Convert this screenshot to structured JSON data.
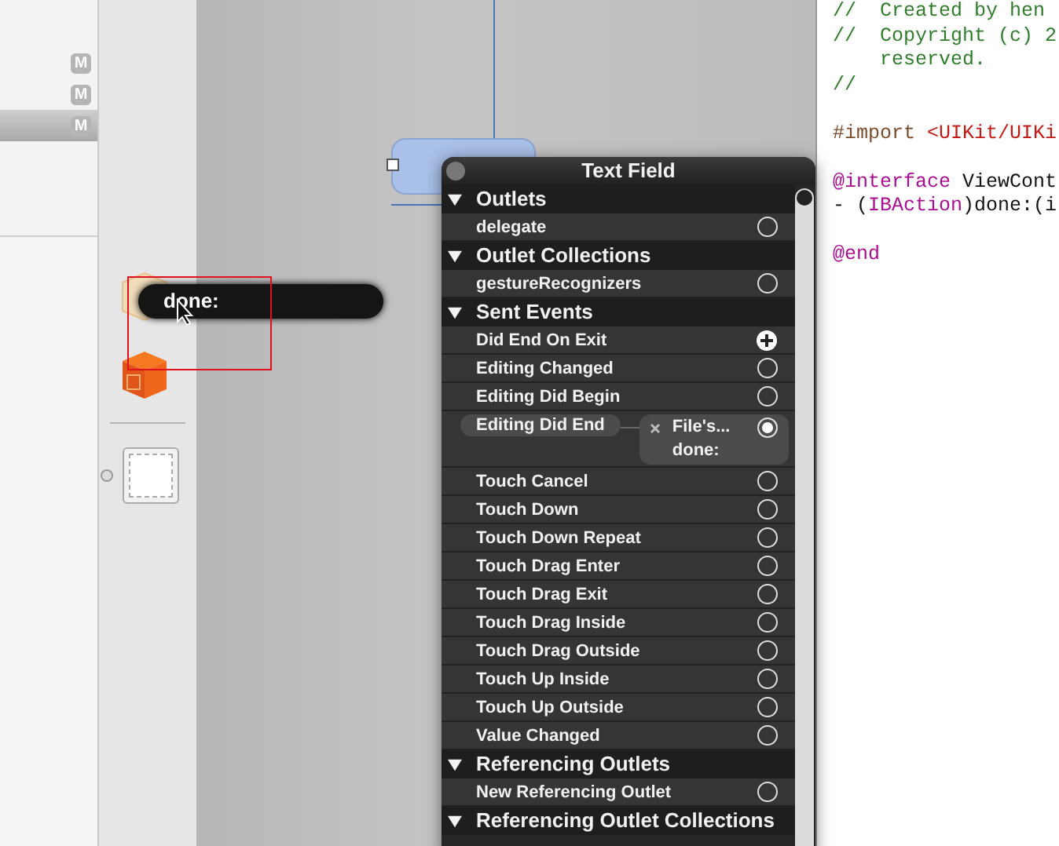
{
  "file_list": {
    "rows": [
      {
        "badge": "M",
        "selected": false
      },
      {
        "badge": "M",
        "selected": false
      },
      {
        "badge": "M",
        "selected": true
      }
    ]
  },
  "drag_tooltip": {
    "text": "done:"
  },
  "connections_panel": {
    "title": "Text Field",
    "sections": [
      {
        "title": "Outlets",
        "expanded": true,
        "rows": [
          {
            "label": "delegate",
            "kind": "empty"
          }
        ]
      },
      {
        "title": "Outlet Collections",
        "expanded": true,
        "rows": [
          {
            "label": "gestureRecognizers",
            "kind": "empty"
          }
        ]
      },
      {
        "title": "Sent Events",
        "expanded": true,
        "rows": [
          {
            "label": "Did End On Exit",
            "kind": "adding"
          },
          {
            "label": "Editing Changed",
            "kind": "empty"
          },
          {
            "label": "Editing Did Begin",
            "kind": "empty"
          },
          {
            "label": "Editing Did End",
            "kind": "connected",
            "target": "File's...",
            "action": "done:"
          },
          {
            "label": "Touch Cancel",
            "kind": "empty"
          },
          {
            "label": "Touch Down",
            "kind": "empty"
          },
          {
            "label": "Touch Down Repeat",
            "kind": "empty"
          },
          {
            "label": "Touch Drag Enter",
            "kind": "empty"
          },
          {
            "label": "Touch Drag Exit",
            "kind": "empty"
          },
          {
            "label": "Touch Drag Inside",
            "kind": "empty"
          },
          {
            "label": "Touch Drag Outside",
            "kind": "empty"
          },
          {
            "label": "Touch Up Inside",
            "kind": "empty"
          },
          {
            "label": "Touch Up Outside",
            "kind": "empty"
          },
          {
            "label": "Value Changed",
            "kind": "empty"
          }
        ]
      },
      {
        "title": "Referencing Outlets",
        "expanded": true,
        "rows": [
          {
            "label": "New Referencing Outlet",
            "kind": "empty"
          }
        ]
      },
      {
        "title": "Referencing Outlet Collections",
        "expanded": true
      }
    ]
  },
  "code_editor": {
    "blocks": [
      {
        "lines": [
          {
            "tokens": [
              {
                "kind": "comment",
                "text": "//  Created by hen"
              }
            ]
          },
          {
            "tokens": [
              {
                "kind": "comment",
                "text": "//  Copyright (c) 2"
              }
            ]
          },
          {
            "tokens": [
              {
                "kind": "comment",
                "text": "    reserved."
              }
            ]
          },
          {
            "tokens": [
              {
                "kind": "comment",
                "text": "//"
              }
            ]
          }
        ]
      },
      {
        "lines": [
          {
            "tokens": [
              {
                "kind": "directive",
                "text": "#import"
              },
              {
                "kind": "string",
                "text": " <UIKit/UIKi"
              }
            ]
          }
        ]
      },
      {
        "lines": [
          {
            "tokens": [
              {
                "kind": "keyword",
                "text": "@interface"
              },
              {
                "kind": "plain",
                "text": " ViewCont"
              }
            ]
          },
          {
            "tokens": [
              {
                "kind": "plain",
                "text": "- ("
              },
              {
                "kind": "keyword",
                "text": "IBAction"
              },
              {
                "kind": "plain",
                "text": ")done:(i"
              }
            ]
          }
        ]
      },
      {
        "lines": [
          {
            "tokens": [
              {
                "kind": "keyword",
                "text": "@end"
              }
            ]
          }
        ]
      }
    ]
  }
}
